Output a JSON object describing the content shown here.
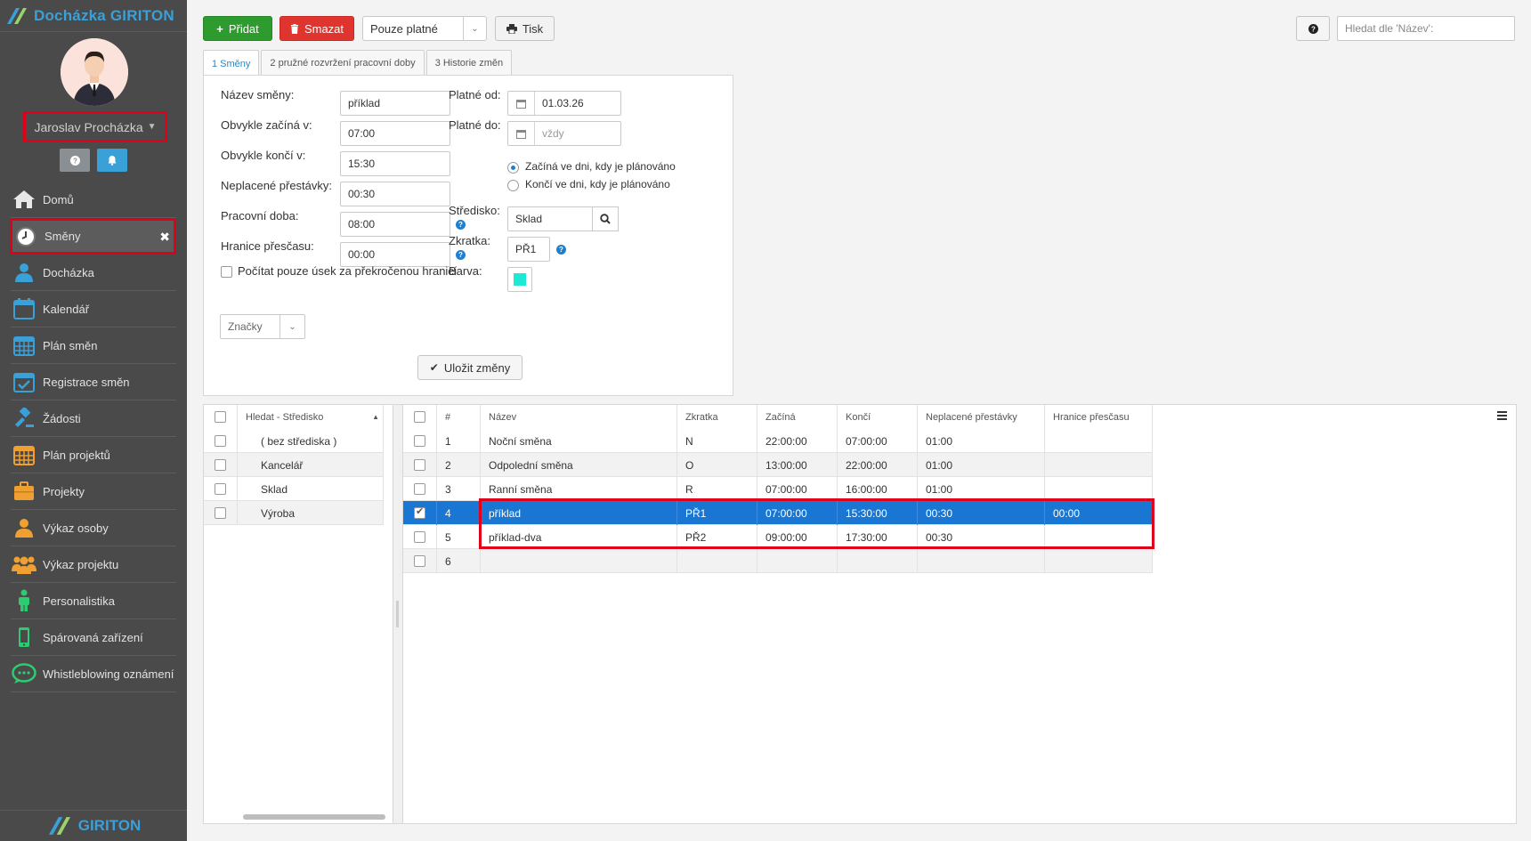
{
  "app": {
    "brand": "Docházka GIRITON",
    "footer_brand": "GIRITON"
  },
  "user": {
    "name": "Jaroslav Procházka"
  },
  "sidebar": {
    "items": [
      {
        "label": "Domů",
        "icon": "home-icon"
      },
      {
        "label": "Směny",
        "icon": "clock-icon"
      },
      {
        "label": "Docházka",
        "icon": "user-icon"
      },
      {
        "label": "Kalendář",
        "icon": "calendar-icon"
      },
      {
        "label": "Plán směn",
        "icon": "calendar-grid-icon"
      },
      {
        "label": "Registrace směn",
        "icon": "calendar-check-icon"
      },
      {
        "label": "Žádosti",
        "icon": "gavel-icon"
      },
      {
        "label": "Plán projektů",
        "icon": "calendar-grid-icon"
      },
      {
        "label": "Projekty",
        "icon": "briefcase-icon"
      },
      {
        "label": "Výkaz osoby",
        "icon": "user-icon"
      },
      {
        "label": "Výkaz projektu",
        "icon": "users-icon"
      },
      {
        "label": "Personalistika",
        "icon": "person-icon"
      },
      {
        "label": "Spárovaná zařízení",
        "icon": "phone-icon"
      },
      {
        "label": "Whistleblowing oznámení",
        "icon": "chat-icon"
      }
    ]
  },
  "toolbar": {
    "add_label": "Přidat",
    "delete_label": "Smazat",
    "filter_value": "Pouze platné",
    "print_label": "Tisk",
    "search_placeholder": "Hledat dle 'Název':"
  },
  "tabs": [
    {
      "label": "1 Směny"
    },
    {
      "label": "2 pružné rozvržení pracovní doby"
    },
    {
      "label": "3 Historie změn"
    }
  ],
  "form": {
    "name_label": "Název směny:",
    "name_value": "příklad",
    "start_label": "Obvykle začíná v:",
    "start_value": "07:00",
    "end_label": "Obvykle končí v:",
    "end_value": "15:30",
    "breaks_label": "Neplacené přestávky:",
    "breaks_value": "00:30",
    "workhours_label": "Pracovní doba:",
    "workhours_value": "08:00",
    "overtime_label": "Hranice přesčasu:",
    "overtime_value": "00:00",
    "count_only_label": "Počítat pouze úsek za překročenou hranicí",
    "tags_label": "Značky",
    "valid_from_label": "Platné od:",
    "valid_from_value": "01.03.26",
    "valid_to_label": "Platné do:",
    "valid_to_placeholder": "vždy",
    "radio_start": "Začíná ve dni, kdy je plánováno",
    "radio_end": "Končí ve dni, kdy je plánováno",
    "center_label": "Středisko:",
    "center_value": "Sklad",
    "abbr_label": "Zkratka:",
    "abbr_value": "PŘ1",
    "color_label": "Barva:",
    "color_value": "#1de9d6",
    "save_label": "Uložit změny"
  },
  "centers": {
    "header": "Hledat - Středisko",
    "rows": [
      "( bez střediska )",
      "Kancelář",
      "Sklad",
      "Výroba"
    ]
  },
  "shifts": {
    "headers": [
      "#",
      "Název",
      "Zkratka",
      "Začíná",
      "Končí",
      "Neplacené přestávky",
      "Hranice přesčasu"
    ],
    "rows": [
      {
        "num": "1",
        "name": "Noční směna",
        "abbr": "N",
        "start": "22:00:00",
        "end": "07:00:00",
        "breaks": "01:00",
        "overtime": ""
      },
      {
        "num": "2",
        "name": "Odpolední směna",
        "abbr": "O",
        "start": "13:00:00",
        "end": "22:00:00",
        "breaks": "01:00",
        "overtime": ""
      },
      {
        "num": "3",
        "name": "Ranní směna",
        "abbr": "R",
        "start": "07:00:00",
        "end": "16:00:00",
        "breaks": "01:00",
        "overtime": ""
      },
      {
        "num": "4",
        "name": "příklad",
        "abbr": "PŘ1",
        "start": "07:00:00",
        "end": "15:30:00",
        "breaks": "00:30",
        "overtime": "00:00"
      },
      {
        "num": "5",
        "name": "příklad-dva",
        "abbr": "PŘ2",
        "start": "09:00:00",
        "end": "17:30:00",
        "breaks": "00:30",
        "overtime": ""
      },
      {
        "num": "6",
        "name": "",
        "abbr": "",
        "start": "",
        "end": "",
        "breaks": "",
        "overtime": ""
      }
    ]
  }
}
